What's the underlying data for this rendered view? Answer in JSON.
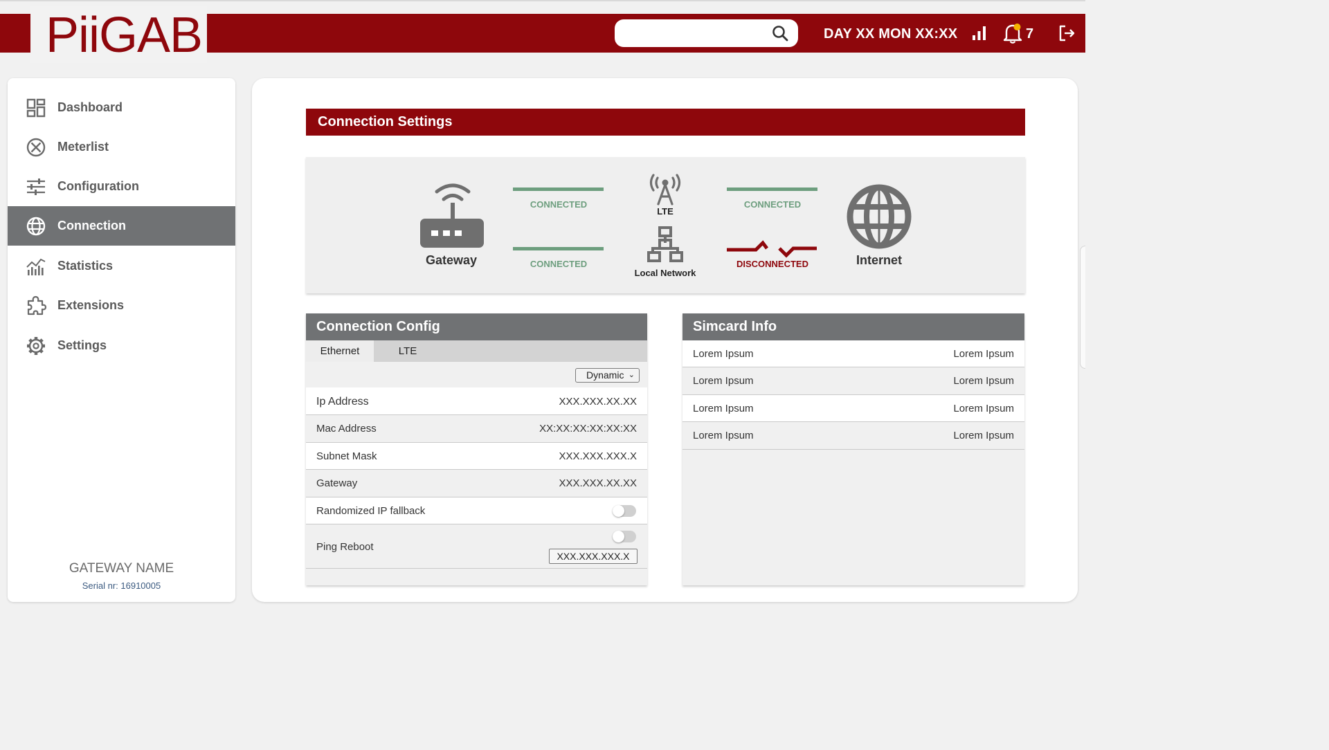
{
  "header": {
    "logo": "PiiGAB",
    "search_placeholder": "",
    "datetime": "DAY XX MON XX:XX",
    "notification_count": "7",
    "colors": {
      "brand": "#8e070c",
      "gray": "#707274"
    }
  },
  "sidebar": {
    "items": [
      {
        "label": "Dashboard",
        "icon": "dashboard-icon"
      },
      {
        "label": "Meterlist",
        "icon": "meterlist-icon"
      },
      {
        "label": "Configuration",
        "icon": "sliders-icon"
      },
      {
        "label": "Connection",
        "icon": "globe-icon",
        "active": true
      },
      {
        "label": "Statistics",
        "icon": "chart-icon"
      },
      {
        "label": "Extensions",
        "icon": "puzzle-icon"
      },
      {
        "label": "Settings",
        "icon": "gear-icon"
      }
    ],
    "gateway_name": "GATEWAY NAME",
    "serial": "Serial nr: 16910005"
  },
  "connection_settings": {
    "title": "Connection Settings",
    "diagram": {
      "gateway_label": "Gateway",
      "lte_label": "LTE",
      "local_network_label": "Local Network",
      "internet_label": "Internet",
      "status_gateway_lte": "CONNECTED",
      "status_gateway_local": "CONNECTED",
      "status_lte_internet": "CONNECTED",
      "status_local_internet": "DISCONNECTED",
      "colors": {
        "connected": "#6d9e7e",
        "disconnected": "#8e070c"
      }
    }
  },
  "connection_config": {
    "title": "Connection Config",
    "tabs": [
      "Ethernet",
      "LTE"
    ],
    "mode": "Dynamic",
    "rows": [
      {
        "label": "Ip Address",
        "value": "XXX.XXX.XX.XX"
      },
      {
        "label": "Mac Address",
        "value": "XX:XX:XX:XX:XX:XX"
      },
      {
        "label": "Subnet Mask",
        "value": "XXX.XXX.XXX.X"
      },
      {
        "label": "Gateway",
        "value": "XXX.XXX.XX.XX"
      }
    ],
    "randomized_label": "Randomized IP fallback",
    "ping_label": "Ping Reboot",
    "ping_ip": "XXX.XXX.XXX.X"
  },
  "simcard_info": {
    "title": "Simcard Info",
    "rows": [
      {
        "key": "Lorem Ipsum",
        "value": "Lorem Ipsum"
      },
      {
        "key": "Lorem Ipsum",
        "value": "Lorem Ipsum"
      },
      {
        "key": "Lorem Ipsum",
        "value": "Lorem Ipsum"
      },
      {
        "key": "Lorem Ipsum",
        "value": "Lorem Ipsum"
      }
    ]
  }
}
